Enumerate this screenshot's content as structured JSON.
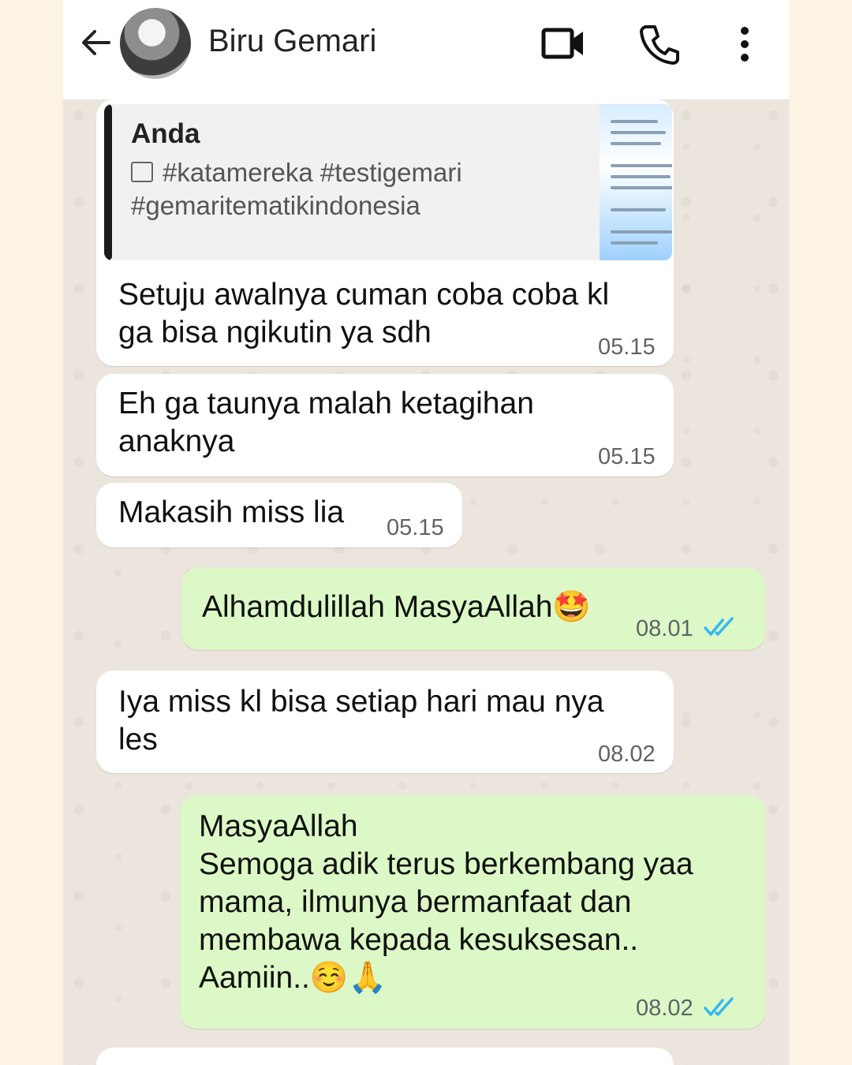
{
  "header": {
    "contact_name": "Biru Gemari",
    "icons": [
      "back-arrow-icon",
      "video-call-icon",
      "voice-call-icon",
      "more-options-icon"
    ]
  },
  "quote": {
    "author": "Anda",
    "text": "#katamereka #testigemari #gemaritematikindonesia",
    "icon": "image-icon"
  },
  "messages": [
    {
      "direction": "in",
      "text": "Setuju awalnya cuman coba coba kl ga bisa ngikutin ya sdh",
      "time": "05.15"
    },
    {
      "direction": "in",
      "text": "Eh ga taunya malah ketagihan anaknya",
      "time": "05.15"
    },
    {
      "direction": "in",
      "text": "Makasih miss lia",
      "time": "05.15"
    },
    {
      "direction": "out",
      "text": "Alhamdulillah MasyaAllah🤩",
      "time": "08.01",
      "status": "read"
    },
    {
      "direction": "in",
      "text": "Iya miss kl bisa setiap hari mau nya les",
      "time": "08.02"
    },
    {
      "direction": "out",
      "text": "MasyaAllah\nSemoga adik terus berkembang yaa mama, ilmunya bermanfaat dan membawa kepada kesuksesan..\nAamiin..☺️🙏",
      "time": "08.02",
      "status": "read"
    }
  ],
  "colors": {
    "incoming_bubble": "#ffffff",
    "outgoing_bubble": "#dcf8c6",
    "read_ticks": "#34b7f1",
    "chat_background": "#ece5dd"
  }
}
